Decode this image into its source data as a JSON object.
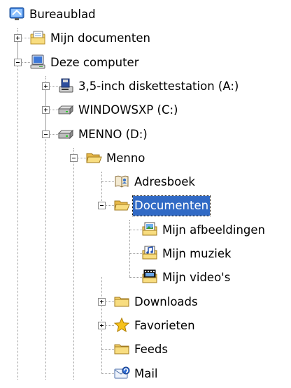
{
  "tree": {
    "nodes": [
      {
        "id": "bureaublad",
        "label": "Bureaublad",
        "level": 0,
        "icon": "desktop-icon",
        "toggle": "none",
        "selected": false
      },
      {
        "id": "mijn-documenten",
        "label": "Mijn documenten",
        "level": 1,
        "icon": "my-documents-icon",
        "toggle": "plus",
        "selected": false
      },
      {
        "id": "deze-computer",
        "label": "Deze computer",
        "level": 1,
        "icon": "my-computer-icon",
        "toggle": "minus",
        "selected": false
      },
      {
        "id": "diskettestation",
        "label": "3,5-inch diskettestation (A:)",
        "level": 2,
        "icon": "floppy-drive-icon",
        "toggle": "plus",
        "selected": false
      },
      {
        "id": "windowsxp",
        "label": "WINDOWSXP (C:)",
        "level": 2,
        "icon": "hard-drive-icon",
        "toggle": "plus",
        "selected": false
      },
      {
        "id": "menno-drive",
        "label": "MENNO (D:)",
        "level": 2,
        "icon": "hard-drive-icon",
        "toggle": "minus",
        "selected": false
      },
      {
        "id": "menno-folder",
        "label": "Menno",
        "level": 3,
        "icon": "open-folder-icon",
        "toggle": "minus",
        "selected": false
      },
      {
        "id": "adresboek",
        "label": "Adresboek",
        "level": 4,
        "icon": "address-book-icon",
        "toggle": "none",
        "selected": false
      },
      {
        "id": "documenten",
        "label": "Documenten",
        "level": 4,
        "icon": "open-folder-icon",
        "toggle": "minus",
        "selected": true
      },
      {
        "id": "mijn-afbeeldingen",
        "label": "Mijn afbeeldingen",
        "level": 5,
        "icon": "pictures-folder-icon",
        "toggle": "none",
        "selected": false
      },
      {
        "id": "mijn-muziek",
        "label": "Mijn muziek",
        "level": 5,
        "icon": "music-folder-icon",
        "toggle": "none",
        "selected": false
      },
      {
        "id": "mijn-videos",
        "label": "Mijn video's",
        "level": 5,
        "icon": "videos-folder-icon",
        "toggle": "none",
        "selected": false
      },
      {
        "id": "downloads",
        "label": "Downloads",
        "level": 4,
        "icon": "folder-icon",
        "toggle": "plus",
        "selected": false
      },
      {
        "id": "favorieten",
        "label": "Favorieten",
        "level": 4,
        "icon": "favorites-star-icon",
        "toggle": "plus",
        "selected": false
      },
      {
        "id": "feeds",
        "label": "Feeds",
        "level": 4,
        "icon": "folder-icon",
        "toggle": "none",
        "selected": false
      },
      {
        "id": "mail",
        "label": "Mail",
        "level": 4,
        "icon": "mail-icon",
        "toggle": "none",
        "selected": false
      }
    ]
  },
  "colors": {
    "selection_background": "#316ac5",
    "selection_text": "#ffffff",
    "folder_yellow": "#f5d36a",
    "guide_lines": "#9a9a9a"
  }
}
